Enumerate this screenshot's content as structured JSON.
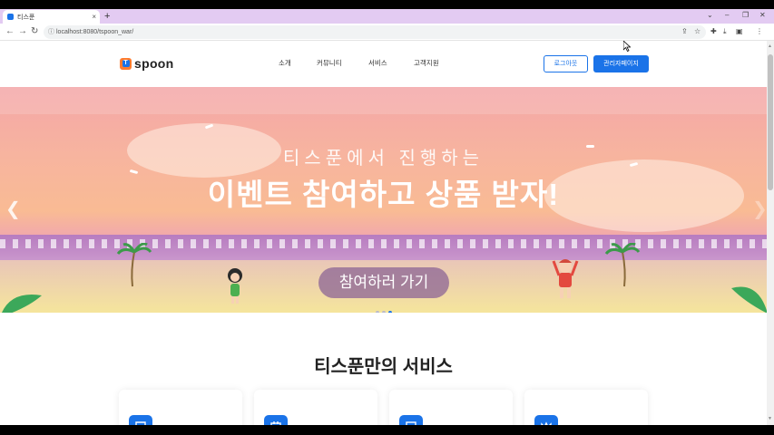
{
  "browser": {
    "tab_title": "티스푼",
    "tab_close": "×",
    "new_tab": "+",
    "url": "localhost:8080/tspoon_war/",
    "back": "←",
    "forward": "→",
    "reload": "↻"
  },
  "header": {
    "logo_text": "spoon",
    "logo_mark": "T",
    "nav": [
      "소개",
      "커뮤니티",
      "서비스",
      "고객지원"
    ],
    "login_label": "로그아웃",
    "admin_label": "관리자페이지"
  },
  "hero": {
    "subtitle": "티스푼에서 진행하는",
    "title": "이벤트 참여하고 상품 받자!",
    "cta_label": "참여하러 가기",
    "slides": 3,
    "active_slide": 3
  },
  "services": {
    "title": "티스푼만의 서비스",
    "cards": [
      {
        "icon": "chat-icon"
      },
      {
        "icon": "calendar-icon"
      },
      {
        "icon": "monitor-icon"
      },
      {
        "icon": "crown-icon"
      }
    ]
  },
  "colors": {
    "primary": "#1a73e8",
    "logo_orange": "#ff7b2e"
  }
}
